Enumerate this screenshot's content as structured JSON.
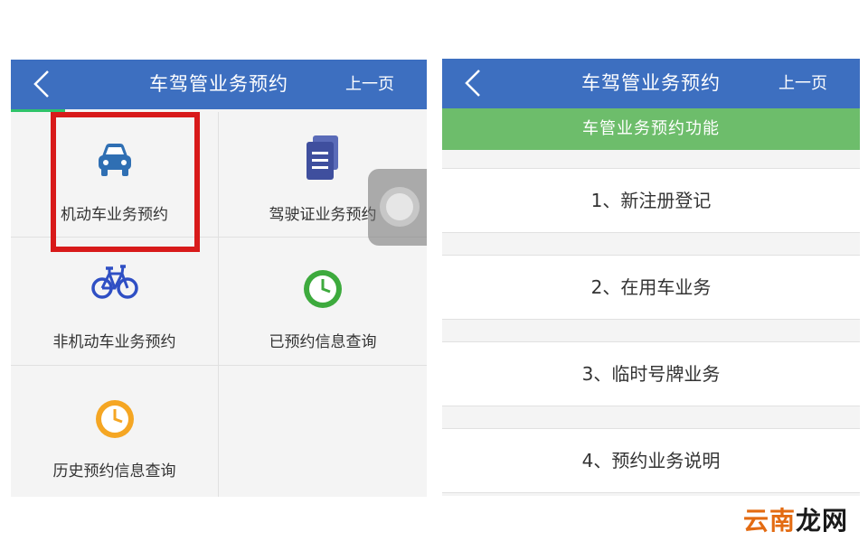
{
  "left_screen": {
    "header": {
      "title": "车驾管业务预约",
      "prev_page": "上一页"
    },
    "grid": [
      {
        "label": "机动车业务预约",
        "icon": "car-icon",
        "color": "#2f6fb3"
      },
      {
        "label": "驾驶证业务预约",
        "icon": "document-icon",
        "color": "#3f4f9e"
      },
      {
        "label": "非机动车业务预约",
        "icon": "bicycle-icon",
        "color": "#2f4fc4"
      },
      {
        "label": "已预约信息查询",
        "icon": "clock-icon",
        "color": "#3daa3d"
      },
      {
        "label": "历史预约信息查询",
        "icon": "clock-icon",
        "color": "#f5a623"
      }
    ],
    "highlight_color": "#d81a1a"
  },
  "right_screen": {
    "header": {
      "title": "车驾管业务预约",
      "prev_page": "上一页"
    },
    "section_title": "车管业务预约功能",
    "menu": [
      {
        "label": "1、新注册登记"
      },
      {
        "label": "2、在用车业务"
      },
      {
        "label": "3、临时号牌业务"
      },
      {
        "label": "4、预约业务说明"
      }
    ]
  },
  "watermark": {
    "part_a": "云南",
    "part_b": "龙网"
  },
  "colors": {
    "header": "#3d6fc0",
    "section_bar": "#6dbd6b",
    "progress": "#2fc36a"
  }
}
